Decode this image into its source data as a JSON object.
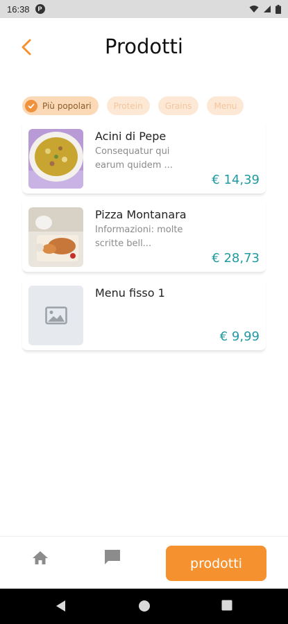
{
  "status": {
    "time": "16:38",
    "app_badge": "P"
  },
  "header": {
    "title": "Prodotti"
  },
  "categories": [
    {
      "label": "Più popolari",
      "active": true
    },
    {
      "label": "Protein",
      "active": false
    },
    {
      "label": "Grains",
      "active": false
    },
    {
      "label": "Menu",
      "active": false
    }
  ],
  "products": [
    {
      "name": "Acini di Pepe",
      "desc": "Consequatur qui earum quidem ...",
      "price": "€ 14,39"
    },
    {
      "name": "Pizza Montanara",
      "desc": "Informazioni: molte scritte bell...",
      "price": "€ 28,73"
    },
    {
      "name": "Menu fisso 1",
      "desc": "",
      "price": "€ 9,99"
    }
  ],
  "bottom_nav": {
    "home_icon": "home-icon",
    "chat_icon": "chat-icon",
    "prodotti_label": "prodotti"
  },
  "colors": {
    "accent": "#f5922f",
    "price": "#1f9aa0",
    "chip_bg": "#fde8d6"
  }
}
